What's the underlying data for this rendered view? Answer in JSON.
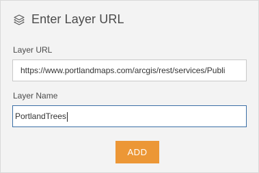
{
  "dialog": {
    "title": "Enter Layer URL",
    "icon": "layers-icon"
  },
  "layer_url": {
    "label": "Layer URL",
    "value": "https://www.portlandmaps.com/arcgis/rest/services/Publi"
  },
  "layer_name": {
    "label": "Layer Name",
    "value": "PortlandTrees"
  },
  "actions": {
    "add_label": "ADD"
  },
  "colors": {
    "panel_bg": "#f3f3f3",
    "add_button": "#ec9736",
    "focus_border": "#3a6ea5"
  }
}
